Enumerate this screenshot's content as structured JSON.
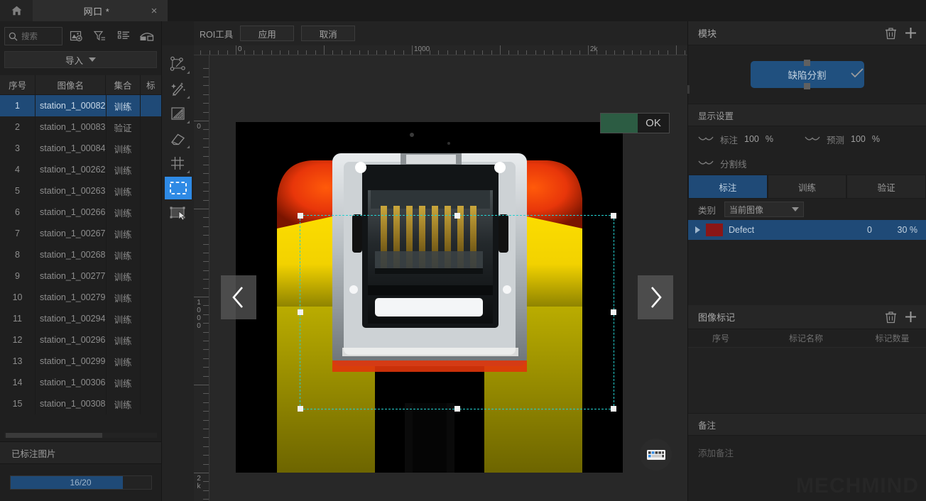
{
  "titlebar": {
    "home_icon": "home-icon",
    "tab_label": "网口 *",
    "close_label": "×"
  },
  "sidebar": {
    "search": {
      "placeholder": "搜索",
      "value": "",
      "icon": "search-icon"
    },
    "toolbar_icons": [
      "image-settings-icon",
      "filter-icon",
      "list-view-icon",
      "compare-shape-icon"
    ],
    "import_label": "导入",
    "table": {
      "columns": [
        "序号",
        "图像名",
        "集合",
        "标"
      ],
      "rows": [
        {
          "idx": "1",
          "name": "station_1_00082",
          "set": "训练"
        },
        {
          "idx": "2",
          "name": "station_1_00083",
          "set": "验证"
        },
        {
          "idx": "3",
          "name": "station_1_00084",
          "set": "训练"
        },
        {
          "idx": "4",
          "name": "station_1_00262",
          "set": "训练"
        },
        {
          "idx": "5",
          "name": "station_1_00263",
          "set": "训练"
        },
        {
          "idx": "6",
          "name": "station_1_00266",
          "set": "训练"
        },
        {
          "idx": "7",
          "name": "station_1_00267",
          "set": "训练"
        },
        {
          "idx": "8",
          "name": "station_1_00268",
          "set": "训练"
        },
        {
          "idx": "9",
          "name": "station_1_00277",
          "set": "训练"
        },
        {
          "idx": "10",
          "name": "station_1_00279",
          "set": "训练"
        },
        {
          "idx": "11",
          "name": "station_1_00294",
          "set": "训练"
        },
        {
          "idx": "12",
          "name": "station_1_00296",
          "set": "训练"
        },
        {
          "idx": "13",
          "name": "station_1_00299",
          "set": "训练"
        },
        {
          "idx": "14",
          "name": "station_1_00306",
          "set": "训练"
        },
        {
          "idx": "15",
          "name": "station_1_00308",
          "set": "训练"
        }
      ],
      "selected_index": 0
    },
    "annotated_section_title": "已标注图片",
    "progress": {
      "text": "16/20",
      "percent": 80,
      "fill_color": "#1f4a77"
    }
  },
  "palette": {
    "tools": [
      {
        "name": "polygon-tool-icon",
        "active": false
      },
      {
        "name": "magic-wand-tool-icon",
        "active": false
      },
      {
        "name": "fill-shape-tool-icon",
        "active": false
      },
      {
        "name": "eraser-tool-icon",
        "active": false
      },
      {
        "name": "grid-tool-icon",
        "active": false
      },
      {
        "name": "rectangle-select-tool-icon",
        "active": true
      },
      {
        "name": "transform-tool-icon",
        "active": false
      }
    ],
    "active_color": "#2e8ae5"
  },
  "canvas": {
    "roi_label": "ROI工具",
    "apply_label": "应用",
    "cancel_label": "取消",
    "ruler_h_labels": [
      "0",
      "1000",
      "2k"
    ],
    "ruler_v_labels": [
      "0",
      "1000",
      "2k"
    ],
    "ok_chip": {
      "label": "OK",
      "swatch_color": "#2c5c43"
    },
    "nav_prev_icon": "chevron-left-icon",
    "nav_next_icon": "chevron-right-icon",
    "keyboard_icon": "keyboard-icon",
    "selection": {
      "color": "#24d0d0",
      "style": "dashed"
    },
    "image_subject": "rj45-ethernet-jack"
  },
  "right_panel": {
    "module": {
      "title": "模块",
      "delete_icon": "trash-icon",
      "add_icon": "plus-icon",
      "button_label": "缺陷分割",
      "check_icon": "check-icon",
      "accent_color": "#20507f"
    },
    "display_settings": {
      "title": "显示设置",
      "rows": [
        {
          "icon": "eye-off-icon",
          "label": "标注",
          "value": "100",
          "unit": "%"
        },
        {
          "icon": "eye-off-icon",
          "label": "预测",
          "value": "100",
          "unit": "%"
        },
        {
          "icon": "eye-off-icon",
          "label": "分割线",
          "value": "",
          "unit": ""
        }
      ]
    },
    "tabs": [
      {
        "label": "标注",
        "active": true
      },
      {
        "label": "训练",
        "active": false
      },
      {
        "label": "验证",
        "active": false
      }
    ],
    "category": {
      "label": "类别",
      "selected": "当前图像",
      "options": [
        "当前图像"
      ]
    },
    "classes": [
      {
        "name": "Defect",
        "color": "#8a1616",
        "count": "0",
        "percent": "30 %"
      }
    ],
    "image_marks": {
      "title": "图像标记",
      "delete_icon": "trash-icon",
      "add_icon": "plus-icon",
      "columns": [
        "序号",
        "标记名称",
        "标记数量"
      ],
      "rows": []
    },
    "note": {
      "title": "备注",
      "placeholder": "添加备注",
      "watermark": "MECHMIND"
    }
  }
}
